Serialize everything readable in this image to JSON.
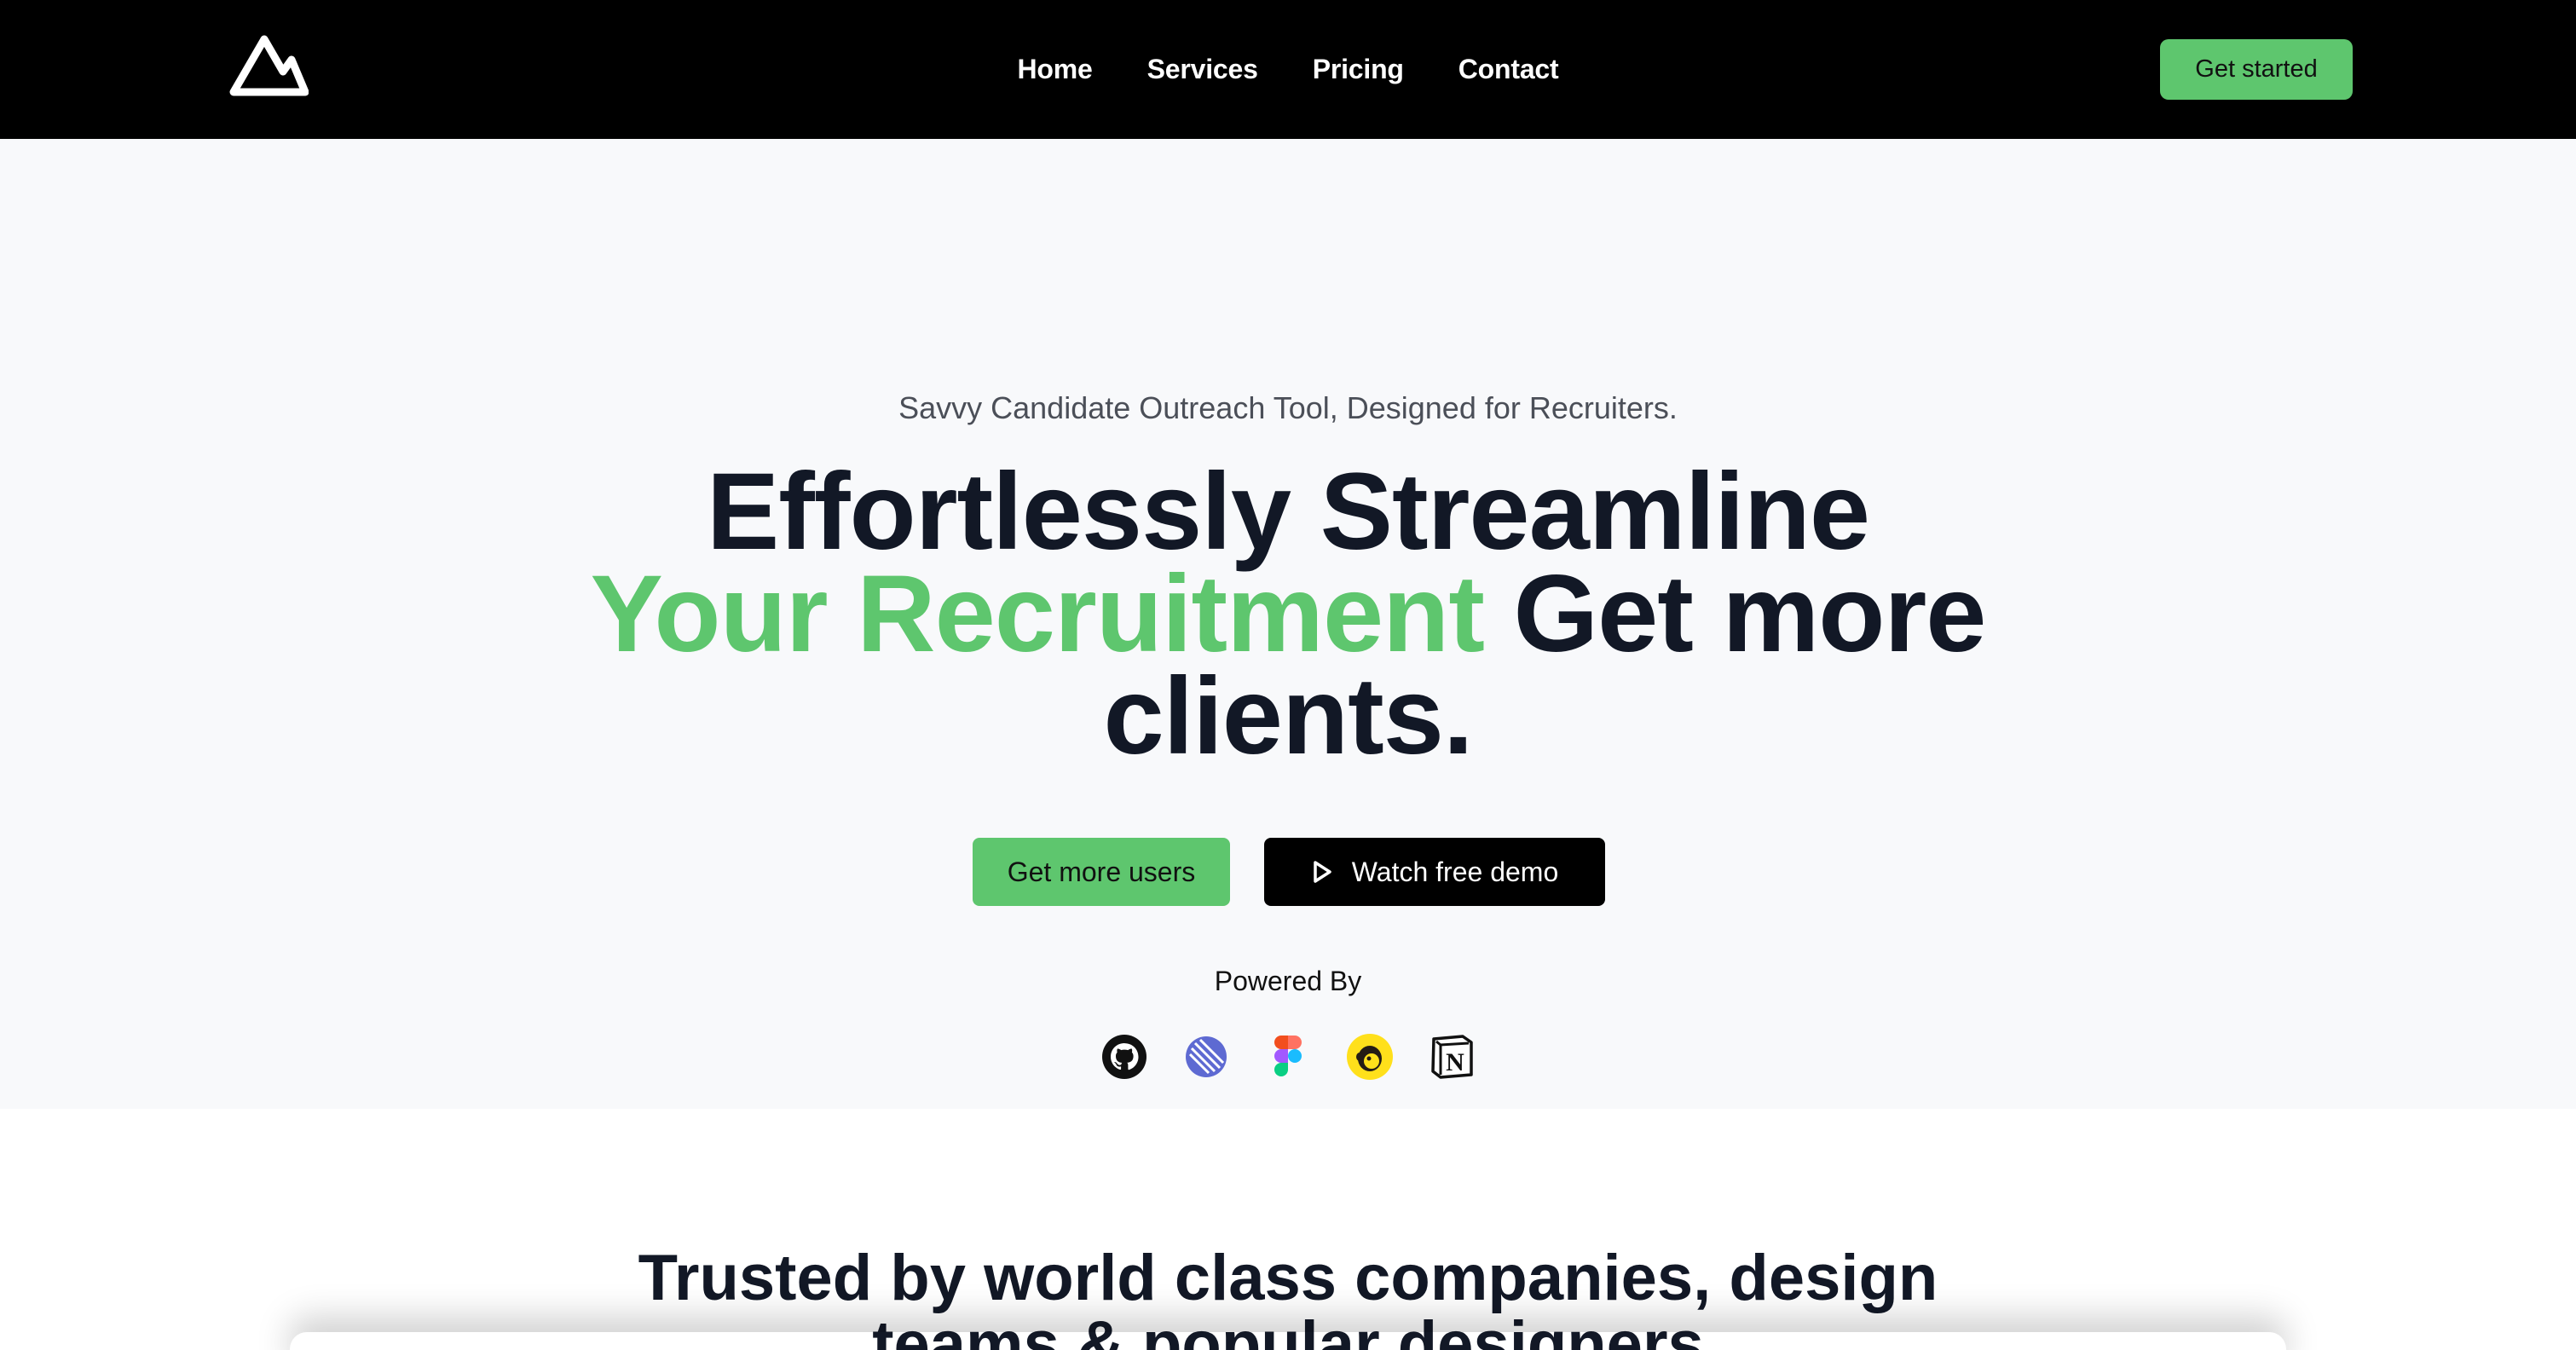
{
  "nav": {
    "logo_icon": "mountain-logo-icon",
    "links": [
      "Home",
      "Services",
      "Pricing",
      "Contact"
    ],
    "cta_label": "Get started"
  },
  "hero": {
    "tagline": "Savvy Candidate Outreach Tool, Designed for Recruiters.",
    "headline_part1": "Effortlessly Streamline",
    "headline_accent": "Your Recruitment",
    "headline_part2": "Get more clients.",
    "primary_button": "Get more users",
    "secondary_button": "Watch free demo",
    "powered_by_label": "Powered By",
    "powered_by_icons": [
      "github-icon",
      "linear-icon",
      "figma-icon",
      "mailchimp-icon",
      "notion-icon"
    ]
  },
  "trusted": {
    "title": "Trusted by world class companies, design teams & popular designers"
  },
  "colors": {
    "accent": "#5ec66e",
    "nav_bg": "#000000",
    "hero_bg": "#f8f9fb",
    "heading": "#121826"
  }
}
